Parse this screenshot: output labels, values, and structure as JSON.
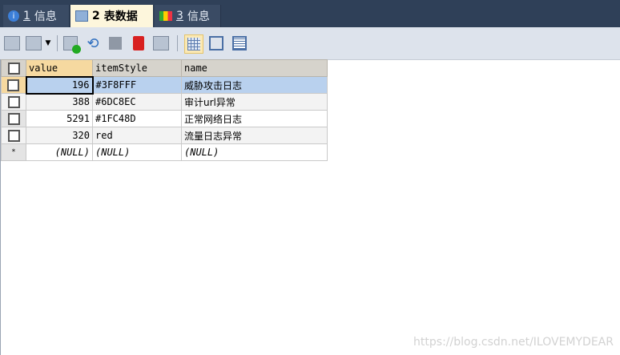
{
  "tabs": [
    {
      "num": "1",
      "label": "信息",
      "icon": "info-icon"
    },
    {
      "num": "2",
      "label": "表数据",
      "icon": "table-icon",
      "active": true
    },
    {
      "num": "3",
      "label": "信息",
      "icon": "shapes-icon"
    }
  ],
  "toolbar": [
    "import-icon",
    "export-icon",
    "add-row-icon",
    "refresh-icon",
    "save-icon",
    "delete-icon",
    "cancel-icon",
    "grid-view-icon",
    "form-view-icon",
    "text-view-icon"
  ],
  "table": {
    "columns": [
      "value",
      "itemStyle",
      "name"
    ],
    "rows": [
      {
        "value": "196",
        "itemStyle": "#3F8FFF",
        "name": "威胁攻击日志"
      },
      {
        "value": "388",
        "itemStyle": "#6DC8EC",
        "name": "审计url异常"
      },
      {
        "value": "5291",
        "itemStyle": "#1FC48D",
        "name": "正常网络日志"
      },
      {
        "value": "320",
        "itemStyle": "red",
        "name": "流量日志异常"
      }
    ],
    "new_row": {
      "marker": "*",
      "value": "(NULL)",
      "itemStyle": "(NULL)",
      "name": "(NULL)"
    }
  },
  "watermark": "https://blog.csdn.net/ILOVEMYDEAR"
}
